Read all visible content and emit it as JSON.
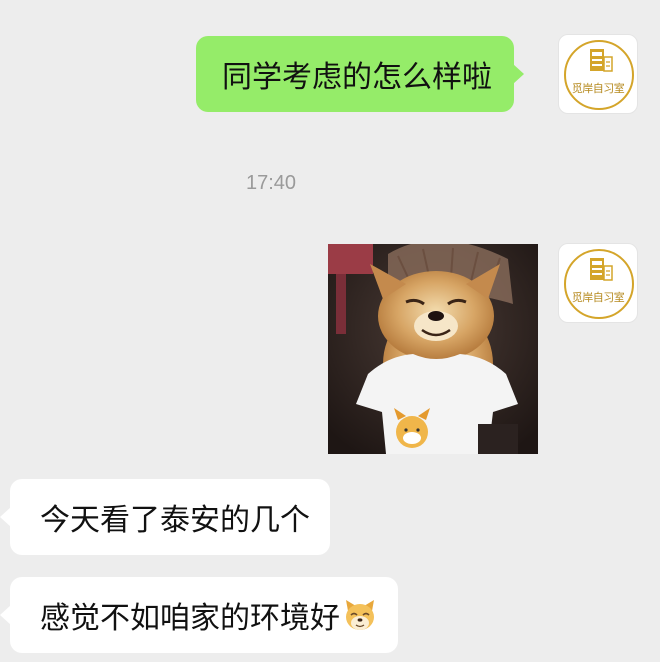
{
  "messages": [
    {
      "direction": "outgoing",
      "text": "同学考虑的怎么样啦"
    },
    {
      "direction": "outgoing",
      "type": "sticker",
      "sticker": "smiling-shiba-dog-in-white-tshirt"
    },
    {
      "direction": "incoming",
      "text": "今天看了泰安的几个"
    },
    {
      "direction": "incoming",
      "text": "感觉不如咱家的环境好",
      "trailing_emoji": "doge-emoji"
    }
  ],
  "timestamp": "17:40",
  "avatar": {
    "text": "觅岸自习室",
    "logo_color": "#d4a52a"
  },
  "colors": {
    "background": "#ededed",
    "outgoing_bubble": "#95ec69",
    "incoming_bubble": "#ffffff",
    "timestamp": "#9a9a9a"
  }
}
